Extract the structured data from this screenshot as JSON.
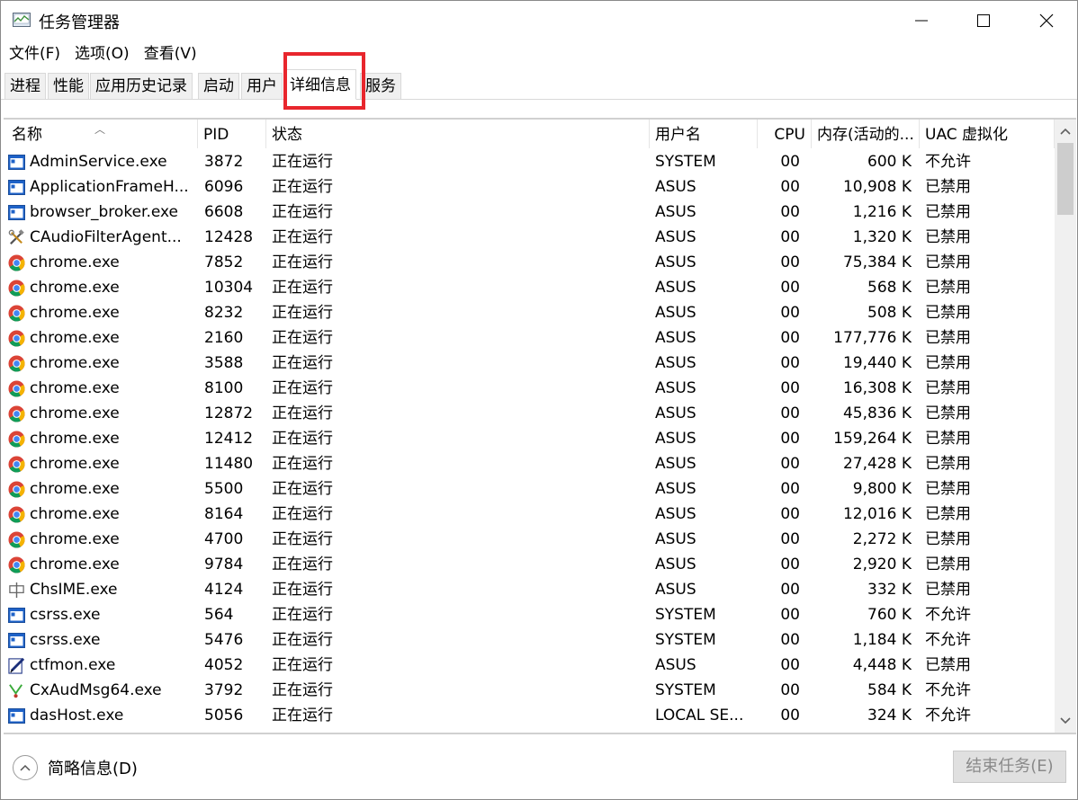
{
  "window": {
    "title": "任务管理器",
    "icon": "task-manager-icon"
  },
  "menu": [
    "文件(F)",
    "选项(O)",
    "查看(V)"
  ],
  "tabs": [
    {
      "label": "进程",
      "active": false
    },
    {
      "label": "性能",
      "active": false
    },
    {
      "label": "应用历史记录",
      "active": false
    },
    {
      "label": "启动",
      "active": false
    },
    {
      "label": "用户",
      "active": false
    },
    {
      "label": "详细信息",
      "active": true
    },
    {
      "label": "服务",
      "active": false
    }
  ],
  "columns": {
    "name": "名称",
    "pid": "PID",
    "status": "状态",
    "user": "用户名",
    "cpu": "CPU",
    "memory": "内存(活动的...",
    "uac": "UAC 虚拟化"
  },
  "processes": [
    {
      "name": "AdminService.exe",
      "pid": "3872",
      "status": "正在运行",
      "user": "SYSTEM",
      "cpu": "00",
      "memory": "600 K",
      "uac": "不允许",
      "icon": "exe-window-icon"
    },
    {
      "name": "ApplicationFrameH...",
      "pid": "6096",
      "status": "正在运行",
      "user": "ASUS",
      "cpu": "00",
      "memory": "10,908 K",
      "uac": "已禁用",
      "icon": "exe-window-icon"
    },
    {
      "name": "browser_broker.exe",
      "pid": "6608",
      "status": "正在运行",
      "user": "ASUS",
      "cpu": "00",
      "memory": "1,216 K",
      "uac": "已禁用",
      "icon": "exe-window-icon"
    },
    {
      "name": "CAudioFilterAgent...",
      "pid": "12428",
      "status": "正在运行",
      "user": "ASUS",
      "cpu": "00",
      "memory": "1,320 K",
      "uac": "已禁用",
      "icon": "tools-icon"
    },
    {
      "name": "chrome.exe",
      "pid": "7852",
      "status": "正在运行",
      "user": "ASUS",
      "cpu": "00",
      "memory": "75,384 K",
      "uac": "已禁用",
      "icon": "chrome-icon"
    },
    {
      "name": "chrome.exe",
      "pid": "10304",
      "status": "正在运行",
      "user": "ASUS",
      "cpu": "00",
      "memory": "568 K",
      "uac": "已禁用",
      "icon": "chrome-icon"
    },
    {
      "name": "chrome.exe",
      "pid": "8232",
      "status": "正在运行",
      "user": "ASUS",
      "cpu": "00",
      "memory": "508 K",
      "uac": "已禁用",
      "icon": "chrome-icon"
    },
    {
      "name": "chrome.exe",
      "pid": "2160",
      "status": "正在运行",
      "user": "ASUS",
      "cpu": "00",
      "memory": "177,776 K",
      "uac": "已禁用",
      "icon": "chrome-icon"
    },
    {
      "name": "chrome.exe",
      "pid": "3588",
      "status": "正在运行",
      "user": "ASUS",
      "cpu": "00",
      "memory": "19,440 K",
      "uac": "已禁用",
      "icon": "chrome-icon"
    },
    {
      "name": "chrome.exe",
      "pid": "8100",
      "status": "正在运行",
      "user": "ASUS",
      "cpu": "00",
      "memory": "16,308 K",
      "uac": "已禁用",
      "icon": "chrome-icon"
    },
    {
      "name": "chrome.exe",
      "pid": "12872",
      "status": "正在运行",
      "user": "ASUS",
      "cpu": "00",
      "memory": "45,836 K",
      "uac": "已禁用",
      "icon": "chrome-icon"
    },
    {
      "name": "chrome.exe",
      "pid": "12412",
      "status": "正在运行",
      "user": "ASUS",
      "cpu": "00",
      "memory": "159,264 K",
      "uac": "已禁用",
      "icon": "chrome-icon"
    },
    {
      "name": "chrome.exe",
      "pid": "11480",
      "status": "正在运行",
      "user": "ASUS",
      "cpu": "00",
      "memory": "27,428 K",
      "uac": "已禁用",
      "icon": "chrome-icon"
    },
    {
      "name": "chrome.exe",
      "pid": "5500",
      "status": "正在运行",
      "user": "ASUS",
      "cpu": "00",
      "memory": "9,800 K",
      "uac": "已禁用",
      "icon": "chrome-icon"
    },
    {
      "name": "chrome.exe",
      "pid": "8164",
      "status": "正在运行",
      "user": "ASUS",
      "cpu": "00",
      "memory": "12,016 K",
      "uac": "已禁用",
      "icon": "chrome-icon"
    },
    {
      "name": "chrome.exe",
      "pid": "4700",
      "status": "正在运行",
      "user": "ASUS",
      "cpu": "00",
      "memory": "2,272 K",
      "uac": "已禁用",
      "icon": "chrome-icon"
    },
    {
      "name": "chrome.exe",
      "pid": "9784",
      "status": "正在运行",
      "user": "ASUS",
      "cpu": "00",
      "memory": "2,920 K",
      "uac": "已禁用",
      "icon": "chrome-icon"
    },
    {
      "name": "ChsIME.exe",
      "pid": "4124",
      "status": "正在运行",
      "user": "ASUS",
      "cpu": "00",
      "memory": "332 K",
      "uac": "已禁用",
      "icon": "ime-icon"
    },
    {
      "name": "csrss.exe",
      "pid": "564",
      "status": "正在运行",
      "user": "SYSTEM",
      "cpu": "00",
      "memory": "760 K",
      "uac": "不允许",
      "icon": "exe-window-icon"
    },
    {
      "name": "csrss.exe",
      "pid": "5476",
      "status": "正在运行",
      "user": "SYSTEM",
      "cpu": "00",
      "memory": "1,184 K",
      "uac": "不允许",
      "icon": "exe-window-icon"
    },
    {
      "name": "ctfmon.exe",
      "pid": "4052",
      "status": "正在运行",
      "user": "ASUS",
      "cpu": "00",
      "memory": "4,448 K",
      "uac": "已禁用",
      "icon": "pen-icon"
    },
    {
      "name": "CxAudMsg64.exe",
      "pid": "3792",
      "status": "正在运行",
      "user": "SYSTEM",
      "cpu": "00",
      "memory": "584 K",
      "uac": "不允许",
      "icon": "audio-icon"
    },
    {
      "name": "dasHost.exe",
      "pid": "5056",
      "status": "正在运行",
      "user": "LOCAL SE...",
      "cpu": "00",
      "memory": "324 K",
      "uac": "不允许",
      "icon": "exe-window-icon"
    }
  ],
  "footer": {
    "collapse_label": "简略信息(D)",
    "end_task_label": "结束任务(E)"
  },
  "colors": {
    "highlight": "#e8262d",
    "exe_icon": "#1e62c8"
  }
}
